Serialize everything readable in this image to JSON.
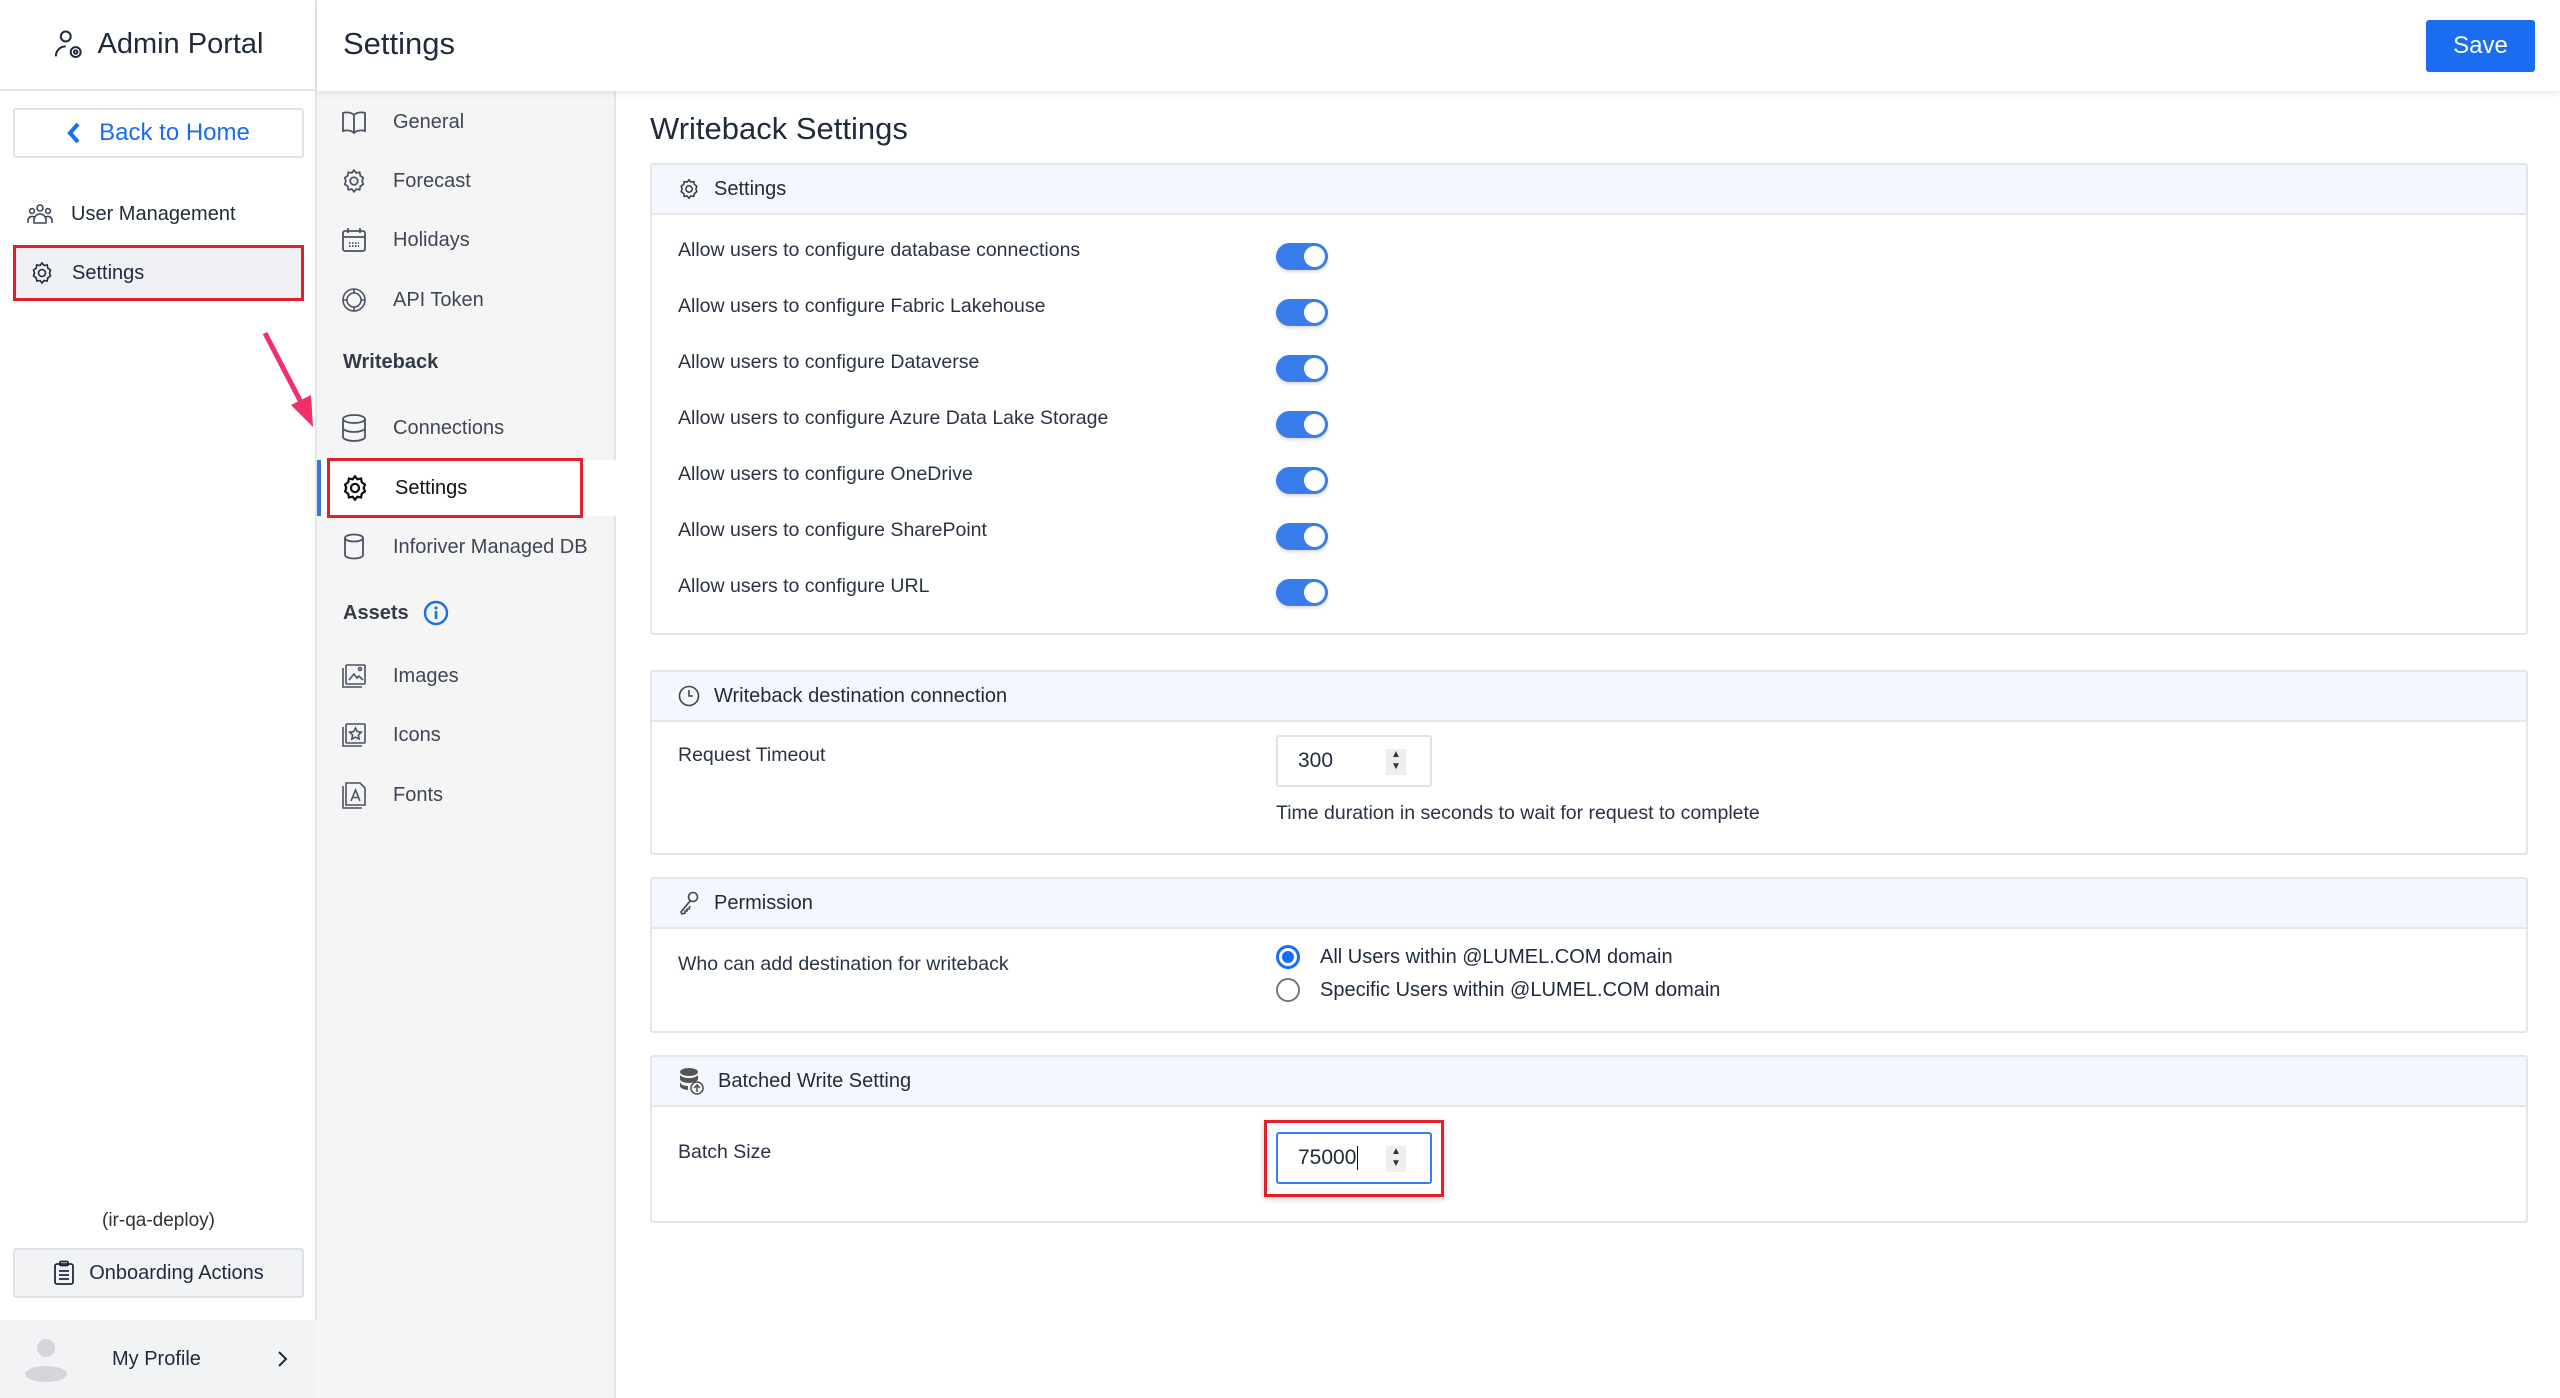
{
  "app": {
    "title": "Admin Portal",
    "back_label": "Back to Home",
    "deployment": "(ir-qa-deploy)",
    "onboarding_label": "Onboarding Actions",
    "profile_label": "My Profile"
  },
  "sidebar": {
    "items": [
      {
        "label": "User Management",
        "icon": "users-icon"
      },
      {
        "label": "Settings",
        "icon": "gear-icon",
        "active": true
      }
    ]
  },
  "header": {
    "title": "Settings",
    "save_label": "Save"
  },
  "subnav": {
    "general": [
      {
        "label": "General",
        "icon": "book-icon"
      },
      {
        "label": "Forecast",
        "icon": "gear-icon"
      },
      {
        "label": "Holidays",
        "icon": "calendar-icon"
      },
      {
        "label": "API Token",
        "icon": "lifebuoy-icon"
      }
    ],
    "writeback_heading": "Writeback",
    "writeback": [
      {
        "label": "Connections",
        "icon": "database-icon"
      },
      {
        "label": "Settings",
        "icon": "gear-icon",
        "active": true
      },
      {
        "label": "Inforiver Managed DB",
        "icon": "cylinder-icon"
      }
    ],
    "assets_heading": "Assets",
    "assets": [
      {
        "label": "Images",
        "icon": "image-icon"
      },
      {
        "label": "Icons",
        "icon": "star-icon"
      },
      {
        "label": "Fonts",
        "icon": "font-icon"
      }
    ]
  },
  "main": {
    "title": "Writeback Settings",
    "settings_panel": {
      "title": "Settings",
      "toggles": [
        {
          "label": "Allow users to configure database connections",
          "on": true
        },
        {
          "label": "Allow users to configure Fabric Lakehouse",
          "on": true
        },
        {
          "label": "Allow users to configure Dataverse",
          "on": true
        },
        {
          "label": "Allow users to configure Azure Data Lake Storage",
          "on": true
        },
        {
          "label": "Allow users to configure OneDrive",
          "on": true
        },
        {
          "label": "Allow users to configure SharePoint",
          "on": true
        },
        {
          "label": "Allow users to configure URL",
          "on": true
        }
      ]
    },
    "destination_panel": {
      "title": "Writeback destination connection",
      "label": "Request Timeout",
      "value": "300",
      "help": "Time duration in seconds to wait for request to complete"
    },
    "permission_panel": {
      "title": "Permission",
      "label": "Who can add destination for writeback",
      "options": [
        {
          "label": "All Users within @LUMEL.COM domain",
          "selected": true
        },
        {
          "label": "Specific Users within @LUMEL.COM domain",
          "selected": false
        }
      ]
    },
    "batch_panel": {
      "title": "Batched Write Setting",
      "label": "Batch Size",
      "value": "75000"
    }
  },
  "colors": {
    "accent": "#1a6cf0",
    "highlight": "#e0202a",
    "toggle": "#3b7ced"
  }
}
